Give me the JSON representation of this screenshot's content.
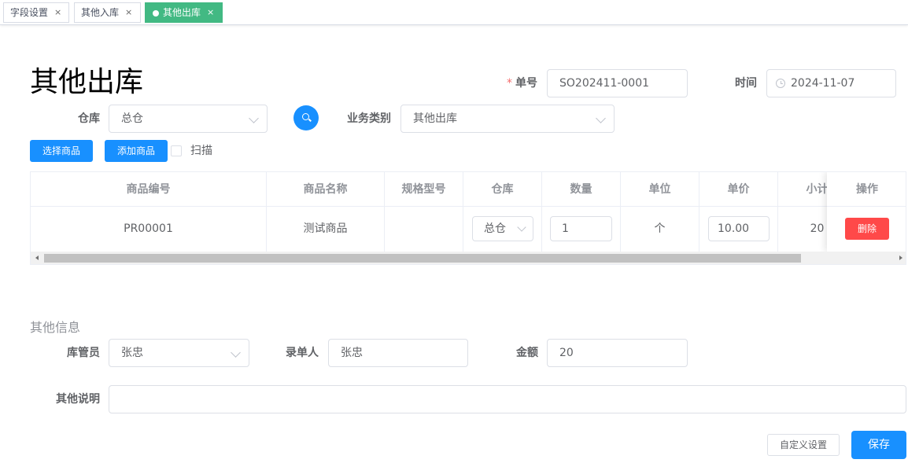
{
  "tabs": [
    {
      "label": "字段设置",
      "close": "×",
      "active": false
    },
    {
      "label": "其他入库",
      "close": "×",
      "active": false
    },
    {
      "label": "其他出库",
      "close": "×",
      "active": true
    }
  ],
  "page_title": "其他出库",
  "form": {
    "order_no": {
      "label": "单号",
      "required": "*",
      "value": "SO202411-0001"
    },
    "time": {
      "label": "时间",
      "value": "2024-11-07"
    },
    "warehouse": {
      "label": "仓库",
      "value": "总仓"
    },
    "business_type": {
      "label": "业务类别",
      "value": "其他出库"
    }
  },
  "toolbar": {
    "select_goods": "选择商品",
    "add_goods": "添加商品",
    "scan": "扫描"
  },
  "table": {
    "columns": [
      "商品编号",
      "商品名称",
      "规格型号",
      "仓库",
      "数量",
      "单位",
      "单价",
      "小计",
      "操作"
    ],
    "rows": [
      {
        "code": "PR00001",
        "name": "测试商品",
        "spec": "",
        "warehouse": "总仓",
        "quantity": "1",
        "unit": "个",
        "price": "10.00",
        "subtotal": "20",
        "action": "删除"
      }
    ]
  },
  "other_info": {
    "title": "其他信息",
    "keeper": {
      "label": "库管员",
      "value": "张忠"
    },
    "recorder": {
      "label": "录单人",
      "value": "张忠"
    },
    "amount": {
      "label": "金额",
      "value": "20"
    },
    "remark": {
      "label": "其他说明",
      "value": ""
    }
  },
  "footer": {
    "custom_settings": "自定义设置",
    "save": "保存"
  },
  "colors": {
    "active_tab": "#42b983",
    "primary": "#1890ff",
    "danger": "#ff4949",
    "required": "#f56c6c"
  }
}
